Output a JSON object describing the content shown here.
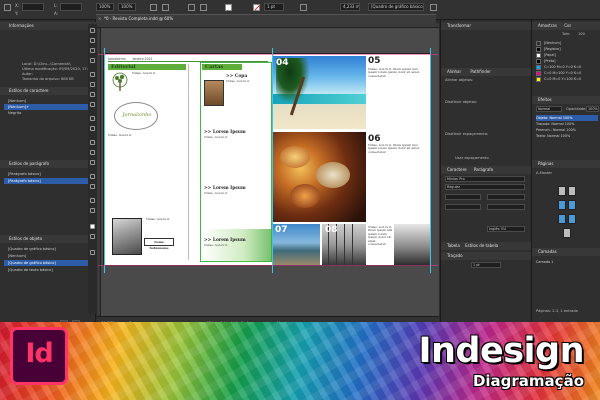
{
  "app": {
    "document_tab": "*0 - Revista Completa.indd @ 60%",
    "zoom": "60%"
  },
  "controlbar": {
    "x_label": "X:",
    "y_label": "Y:",
    "w_label": "L:",
    "h_label": "A:",
    "stroke_weight": "1 pt",
    "percent_a": "100%",
    "percent_b": "100%",
    "measure_value": "4,233 mm",
    "style_dropdown": "[Quadro de gráfico básico]"
  },
  "left_panel": {
    "info_title": "Informações",
    "info_lines": [
      "Local: D:\\Cleu...\\Comercial\\",
      "Última modificação: 09/09/2020, 17:47",
      "Autor:",
      "Tamanho do arquivo: 608 KB"
    ],
    "paragraph_styles_title": "Estilos de caractere",
    "paragraph_items": [
      "[Nenhum]",
      "[Nenhum]+",
      "Negrito"
    ],
    "para_styles_title": "Estilos de parágrafo",
    "para_items": [
      "[Parágrafo básico]",
      "[Parágrafo básico]"
    ],
    "object_styles_title": "Estilos de objeto",
    "object_items": [
      "[Quadro de gráfico básico]",
      "[Nenhum]",
      "[Quadro de gráfico básico]",
      "[Quadro de texto básico]"
    ]
  },
  "newsletter": {
    "header_items": [
      "Jornalzinho",
      "Janeiro 2021"
    ],
    "editorial_title": "Editorial",
    "cartas_title": "Cartas",
    "seal_text": "Jornalzinho",
    "pull_quote": "Nome Sobrenome",
    "copa_title": ">> Copa",
    "lorem_title": ">> Lorem Ipsum",
    "lorem_body": "Nulas, non-fu il. "
  },
  "photos": {
    "numbers": [
      "04",
      "05",
      "06",
      "07",
      "08"
    ],
    "caption": "Nulas, non fu il. Illum ipsum nisi ipsam lorem ipsum dolor sit amet, consectetur"
  },
  "right_panel_mid": {
    "transform_title": "Transformar",
    "tab_aligns": "Alinhar",
    "tab_pathfinder": "Pathfinder",
    "align_objects": "Alinhar objetos:",
    "distribute_objects": "Distribuir objetos:",
    "distribute_spacing": "Distribuir espaçamento:",
    "use_spacing": "Usar espaçamento",
    "char_title": "Caractere",
    "tab_paragraph": "Parágrafo",
    "tab_opentype": "Tratado de um",
    "font_field": "Minion Pro",
    "font_style": "Regular",
    "language": "Inglês: EU",
    "tables_tab": "Tabela",
    "table_styles_tab": "Estilos de tabela",
    "cell_styles_tab": "Estilos de célula",
    "stroke_title": "Traçado",
    "stroke_weight": "1 pt"
  },
  "right_panel_far": {
    "swatches_title": "Amostras",
    "color_tab": "Cor",
    "tint_label": "Tom:",
    "tint_value": "100",
    "swatches": [
      {
        "name": "[Nenhum]",
        "color": "#ffffff"
      },
      {
        "name": "[Registro]",
        "color": "#000000"
      },
      {
        "name": "[Papel]",
        "color": "#ffffff"
      },
      {
        "name": "[Preto]",
        "color": "#000000"
      },
      {
        "name": "C=100 M=0 Y=0 K=0",
        "color": "#00aeef"
      },
      {
        "name": "C=0 M=100 Y=0 K=0",
        "color": "#ec008c"
      },
      {
        "name": "C=0 M=0 Y=100 K=0",
        "color": "#fff200"
      }
    ],
    "effects_title": "Efeitos",
    "blend_mode": "Normal",
    "opacity_label": "Opacidade:",
    "opacity_value": "100%",
    "effects_items": [
      "Objeto: Normal 100%",
      "Traçado: Normal 100%",
      "Preench.: Normal 100%",
      "Texto: Normal 100%"
    ],
    "pages_title": "Páginas",
    "master": "A-Master",
    "pages_footer": "Páginas: 2-3, 1 entrada",
    "layers_title": "Camadas",
    "layer_name": "Camada 1",
    "wrap_title": "Ajuste de texto"
  },
  "status": {
    "zoom": "60,77%",
    "style": "[Básico] (de trabalho)",
    "errors": "Nenhum erro",
    "page": "3"
  },
  "banner": {
    "logo_text": "Id",
    "title": "Indesign",
    "subtitle": "Diagramação"
  }
}
